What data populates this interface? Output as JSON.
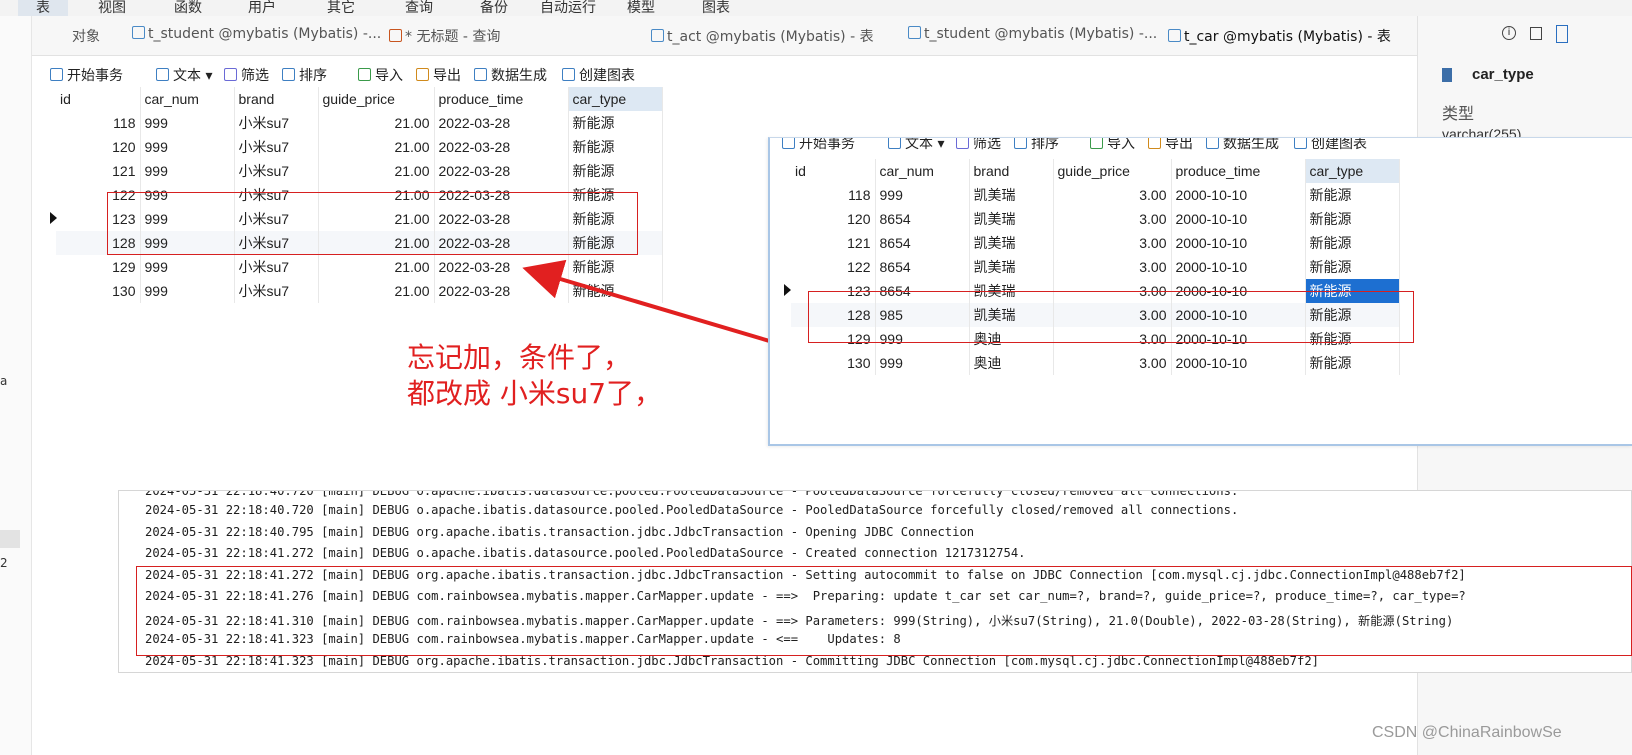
{
  "menubar": {
    "items": [
      "表",
      "视图",
      "函数",
      "用户",
      "其它",
      "查询",
      "备份",
      "自动运行",
      "模型",
      "图表"
    ]
  },
  "left_strip": {
    "chars": [
      "a",
      "2"
    ]
  },
  "tabs": {
    "objects_label": "对象",
    "items": [
      {
        "label": "t_student @mybatis (Mybatis) -...",
        "icon": "table-icon"
      },
      {
        "label": "* 无标题 - 查询",
        "icon": "query-icon"
      },
      {
        "label": "t_act @mybatis (Mybatis) - 表",
        "icon": "table-icon"
      },
      {
        "label": "t_student @mybatis (Mybatis) -...",
        "icon": "table-icon"
      },
      {
        "label": "t_car @mybatis (Mybatis) - 表",
        "icon": "table-icon"
      }
    ]
  },
  "right_panel": {
    "icons": [
      "info-icon",
      "ddl-icon",
      "panel-icon"
    ],
    "field_name": "car_type",
    "type_label": "类型",
    "type_value": "varchar(255)"
  },
  "toolbar": {
    "begin_transaction": "开始事务",
    "text": "文本",
    "filter": "筛选",
    "sort": "排序",
    "import": "导入",
    "export": "导出",
    "data_generation": "数据生成",
    "create_chart": "创建图表"
  },
  "main_grid": {
    "columns": [
      "id",
      "car_num",
      "brand",
      "guide_price",
      "produce_time",
      "car_type"
    ],
    "rows": [
      [
        "118",
        "999",
        "小米su7",
        "21.00",
        "2022-03-28",
        "新能源"
      ],
      [
        "120",
        "999",
        "小米su7",
        "21.00",
        "2022-03-28",
        "新能源"
      ],
      [
        "121",
        "999",
        "小米su7",
        "21.00",
        "2022-03-28",
        "新能源"
      ],
      [
        "122",
        "999",
        "小米su7",
        "21.00",
        "2022-03-28",
        "新能源"
      ],
      [
        "123",
        "999",
        "小米su7",
        "21.00",
        "2022-03-28",
        "新能源"
      ],
      [
        "128",
        "999",
        "小米su7",
        "21.00",
        "2022-03-28",
        "新能源"
      ],
      [
        "129",
        "999",
        "小米su7",
        "21.00",
        "2022-03-28",
        "新能源"
      ],
      [
        "130",
        "999",
        "小米su7",
        "21.00",
        "2022-03-28",
        "新能源"
      ]
    ]
  },
  "overlay_grid": {
    "columns": [
      "id",
      "car_num",
      "brand",
      "guide_price",
      "produce_time",
      "car_type"
    ],
    "rows": [
      [
        "118",
        "999",
        "凯美瑞",
        "3.00",
        "2000-10-10",
        "新能源"
      ],
      [
        "120",
        "8654",
        "凯美瑞",
        "3.00",
        "2000-10-10",
        "新能源"
      ],
      [
        "121",
        "8654",
        "凯美瑞",
        "3.00",
        "2000-10-10",
        "新能源"
      ],
      [
        "122",
        "8654",
        "凯美瑞",
        "3.00",
        "2000-10-10",
        "新能源"
      ],
      [
        "123",
        "8654",
        "凯美瑞",
        "3.00",
        "2000-10-10",
        "新能源"
      ],
      [
        "128",
        "985",
        "凯美瑞",
        "3.00",
        "2000-10-10",
        "新能源"
      ],
      [
        "129",
        "999",
        "奥迪",
        "3.00",
        "2000-10-10",
        "新能源"
      ],
      [
        "130",
        "999",
        "奥迪",
        "3.00",
        "2000-10-10",
        "新能源"
      ]
    ]
  },
  "annotation": {
    "line1": "忘记加，条件了，",
    "line2": "都改成 小米su7了，"
  },
  "console": {
    "lines": [
      "2024-05-31 22:18:40.720 [main] DEBUG o.apache.ibatis.datasource.pooled.PooledDataSource - PooledDataSource forcefully closed/removed all connections.",
      "2024-05-31 22:18:40.795 [main] DEBUG org.apache.ibatis.transaction.jdbc.JdbcTransaction - Opening JDBC Connection",
      "2024-05-31 22:18:41.272 [main] DEBUG o.apache.ibatis.datasource.pooled.PooledDataSource - Created connection 1217312754.",
      "2024-05-31 22:18:41.272 [main] DEBUG org.apache.ibatis.transaction.jdbc.JdbcTransaction - Setting autocommit to false on JDBC Connection [com.mysql.cj.jdbc.ConnectionImpl@488eb7f2]",
      "2024-05-31 22:18:41.276 [main] DEBUG com.rainbowsea.mybatis.mapper.CarMapper.update - ==>  Preparing: update t_car set car_num=?, brand=?, guide_price=?, produce_time=?, car_type=?",
      "2024-05-31 22:18:41.310 [main] DEBUG com.rainbowsea.mybatis.mapper.CarMapper.update - ==> Parameters: 999(String), 小米su7(String), 21.0(Double), 2022-03-28(String), 新能源(String)",
      "2024-05-31 22:18:41.323 [main] DEBUG com.rainbowsea.mybatis.mapper.CarMapper.update - <==    Updates: 8",
      "2024-05-31 22:18:41.323 [main] DEBUG org.apache.ibatis.transaction.jdbc.JdbcTransaction - Committing JDBC Connection [com.mysql.cj.jdbc.ConnectionImpl@488eb7f2]"
    ]
  },
  "watermark": "CSDN @ChinaRainbowSe",
  "colors": {
    "annotation_red": "#e12020",
    "selected_cell_blue": "#1d6fd1",
    "header_selected": "#dde8f3"
  }
}
